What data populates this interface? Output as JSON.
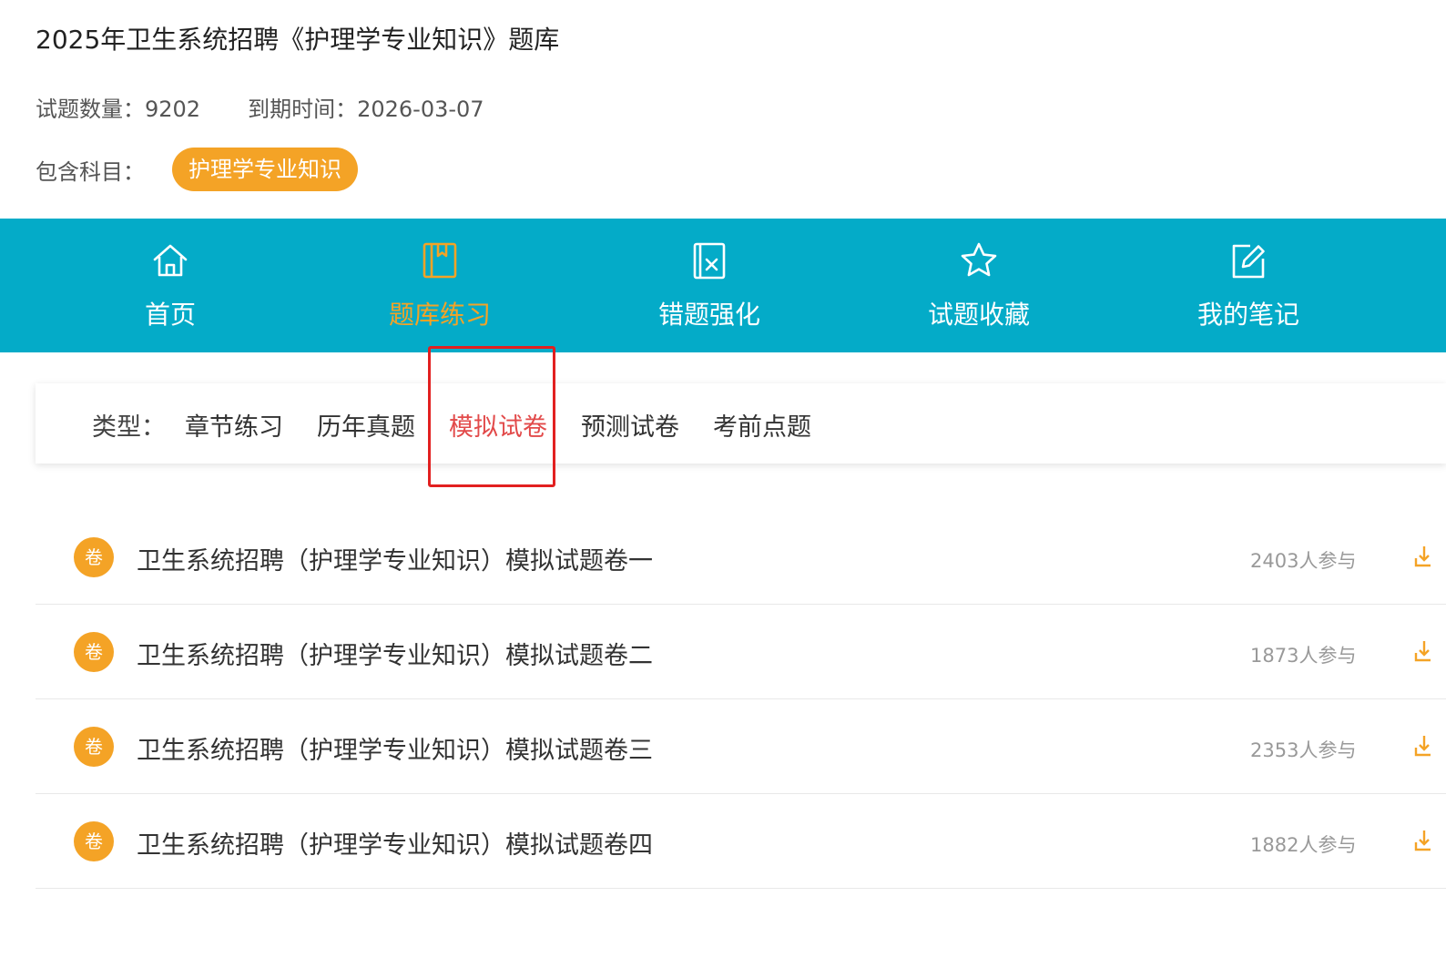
{
  "header": {
    "title": "2025年卫生系统招聘《护理学专业知识》题库",
    "question_count_label": "试题数量：",
    "question_count": "9202",
    "expiry_label": "到期时间：",
    "expiry_date": "2026-03-07",
    "subjects_label": "包含科目：",
    "subjects": [
      "护理学专业知识"
    ]
  },
  "nav": {
    "items": [
      {
        "label": "首页",
        "icon": "home-icon"
      },
      {
        "label": "题库练习",
        "icon": "book-icon",
        "active": true
      },
      {
        "label": "错题强化",
        "icon": "wrong-question-icon"
      },
      {
        "label": "试题收藏",
        "icon": "star-icon"
      },
      {
        "label": "我的笔记",
        "icon": "edit-note-icon"
      }
    ]
  },
  "types": {
    "label": "类型：",
    "items": [
      {
        "label": "章节练习"
      },
      {
        "label": "历年真题"
      },
      {
        "label": "模拟试卷",
        "active": true
      },
      {
        "label": "预测试卷"
      },
      {
        "label": "考前点题"
      }
    ]
  },
  "papers": [
    {
      "badge": "卷",
      "title": "卫生系统招聘（护理学专业知识）模拟试题卷一",
      "participants": "2403人参与"
    },
    {
      "badge": "卷",
      "title": "卫生系统招聘（护理学专业知识）模拟试题卷二",
      "participants": "1873人参与"
    },
    {
      "badge": "卷",
      "title": "卫生系统招聘（护理学专业知识）模拟试题卷三",
      "participants": "2353人参与"
    },
    {
      "badge": "卷",
      "title": "卫生系统招聘（护理学专业知识）模拟试题卷四",
      "participants": "1882人参与"
    }
  ],
  "colors": {
    "nav_background": "#04abc8",
    "accent_orange": "#f4a326",
    "active_type_red": "#e24a4a",
    "highlight_box_red": "#e22020"
  }
}
